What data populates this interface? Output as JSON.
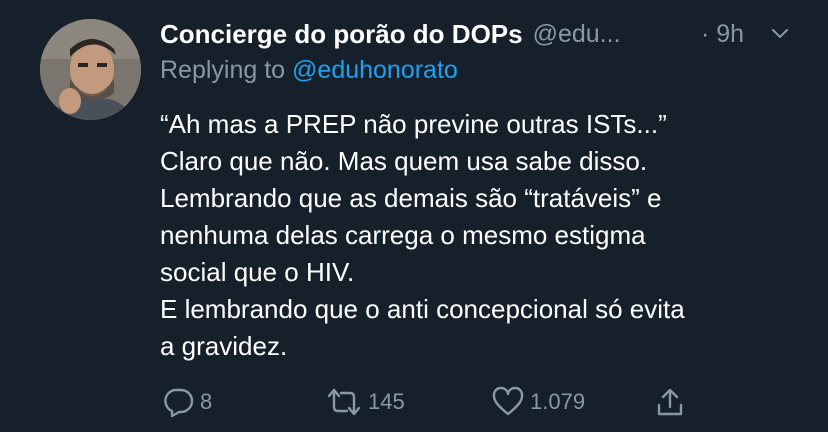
{
  "tweet": {
    "display_name": "Concierge do porão do DOPs",
    "handle": "@edu...",
    "time": "· 9h",
    "reply_prefix": "Replying to",
    "reply_to": "@eduhonorato",
    "lines": [
      "“Ah mas a PREP não previne outras ISTs...”",
      "Claro que não. Mas quem usa sabe disso.",
      "Lembrando que as demais são “tratáveis” e",
      "nenhuma delas carrega o mesmo estigma",
      "social que o HIV.",
      "E lembrando que o anti concepcional só evita",
      "a gravidez."
    ]
  },
  "actions": {
    "replies": "8",
    "retweets": "145",
    "likes": "1.079"
  },
  "colors": {
    "background": "#15202b",
    "primary_text": "#ffffff",
    "secondary_text": "#8899a6",
    "accent": "#1da1f2"
  },
  "icons": [
    "avatar",
    "chevron-down-icon",
    "reply-icon",
    "retweet-icon",
    "like-icon",
    "share-icon"
  ]
}
